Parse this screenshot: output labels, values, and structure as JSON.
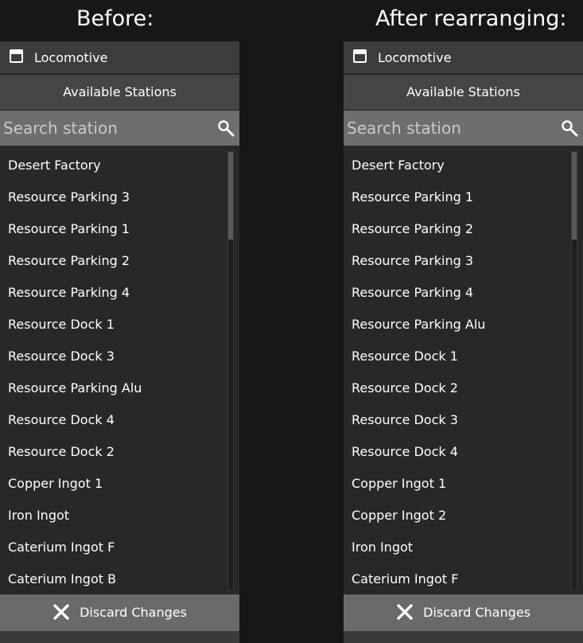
{
  "captions": {
    "before": "Before:",
    "after": "After rearranging:"
  },
  "panels": [
    {
      "title": "Locomotive",
      "header": "Available Stations",
      "search_placeholder": "Search station",
      "stations": [
        "Desert Factory",
        "Resource Parking 3",
        "Resource Parking 1",
        "Resource Parking 2",
        "Resource Parking 4",
        "Resource Dock 1",
        "Resource Dock 3",
        "Resource Parking Alu",
        "Resource Dock 4",
        "Resource Dock 2",
        "Copper Ingot 1",
        "Iron Ingot",
        "Caterium Ingot F",
        "Caterium Ingot B"
      ],
      "discard_label": "Discard Changes"
    },
    {
      "title": "Locomotive",
      "header": "Available Stations",
      "search_placeholder": "Search station",
      "stations": [
        "Desert Factory",
        "Resource Parking 1",
        "Resource Parking 2",
        "Resource Parking 3",
        "Resource Parking 4",
        "Resource Parking Alu",
        "Resource Dock 1",
        "Resource Dock 2",
        "Resource Dock 3",
        "Resource Dock 4",
        "Copper Ingot 1",
        "Copper Ingot 2",
        "Iron Ingot",
        "Caterium Ingot F"
      ],
      "discard_label": "Discard Changes"
    }
  ],
  "icons": {
    "window": "window-icon",
    "search": "search-icon",
    "close": "close-icon"
  },
  "colors": {
    "background": "#171717",
    "panel": "#282828",
    "title_bar": "#3c3c3c",
    "header_bar": "#454545",
    "search_bar": "#6e6e6e",
    "button": "#6a6a6a",
    "text": "#ffffff"
  }
}
